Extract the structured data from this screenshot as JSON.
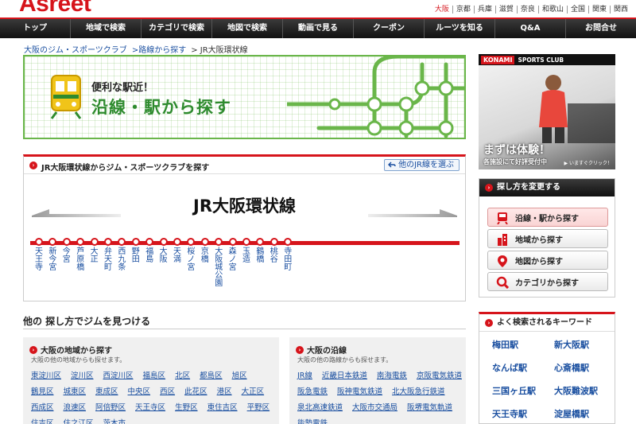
{
  "header": {
    "logo": "Asreet",
    "regions": [
      "大阪",
      "京都",
      "兵庫",
      "滋賀",
      "奈良",
      "和歌山",
      "全国",
      "関東",
      "関西"
    ],
    "active_region": "大阪"
  },
  "nav": [
    "トップ",
    "地域で検索",
    "カテゴリで検索",
    "地図で検索",
    "動画で見る",
    "クーポン",
    "ルーツを知る",
    "Q&A",
    "お問合せ"
  ],
  "breadcrumb": {
    "home": "大阪のジム・スポーツクラブ",
    "parent": ">路線から探す",
    "current": "> JR大阪環状線"
  },
  "banner": {
    "sub": "便利な駅近！",
    "main": "沿線・駅から探す"
  },
  "line_card": {
    "heading": "JR大阪環状線からジム・スポーツクラブを探す",
    "other_button": "他のJR線を選ぶ",
    "line_name": "JR大阪環状線",
    "stations": [
      "天王寺",
      "新今宮",
      "今宮",
      "芦原橋",
      "大正",
      "弁天町",
      "西九条",
      "野田",
      "福島",
      "大阪",
      "天満",
      "桜ノ宮",
      "京橋",
      "大阪城公園",
      "森ノ宮",
      "玉造",
      "鶴橋",
      "桃谷",
      "寺田町"
    ]
  },
  "find": {
    "title": "他の 探し方でジムを見つける",
    "area": {
      "title": "大阪の地域から探す",
      "desc": "大阪の他の地域からも探せます。",
      "links": [
        "東淀川区",
        "淀川区",
        "西淀川区",
        "福島区",
        "北区",
        "都島区",
        "旭区",
        "鶴見区",
        "城東区",
        "東成区",
        "中央区",
        "西区",
        "此花区",
        "港区",
        "大正区",
        "西成区",
        "浪速区",
        "阿倍野区",
        "天王寺区",
        "生野区",
        "東住吉区",
        "平野区",
        "住吉区",
        "住之江区",
        "茨木市"
      ]
    },
    "lines": {
      "title": "大阪の沿線",
      "desc": "大阪の他の路線からも探せます。",
      "links": [
        "JR線",
        "近畿日本鉄道",
        "南海電鉄",
        "京阪電気鉄道",
        "阪急電鉄",
        "阪神電気鉄道",
        "北大阪急行鉄道",
        "泉北高速鉄道",
        "大阪市交通局",
        "阪堺電気軌道",
        "能勢電鉄"
      ]
    }
  },
  "ad": {
    "brand_k": "KONAMI",
    "brand_s": "SPORTS CLUB",
    "caption": "まずは体験！",
    "caption2": "各施設にて好評受付中",
    "caption3": "▶ いますぐクリック！"
  },
  "search_method": {
    "title": "探し方を変更する",
    "buttons": [
      "沿線・駅から探す",
      "地域から探す",
      "地図から探す",
      "カテゴリから探す"
    ]
  },
  "keywords": {
    "title": "よく検索されるキーワード",
    "items": [
      "梅田駅",
      "新大阪駅",
      "なんば駅",
      "心斎橋駅",
      "三国ヶ丘駅",
      "大阪難波駅",
      "天王寺駅",
      "淀屋橋駅"
    ]
  },
  "colors": {
    "brand_red": "#d6141b",
    "banner_green": "#2e8b2e",
    "link_blue": "#1a4fa0"
  }
}
